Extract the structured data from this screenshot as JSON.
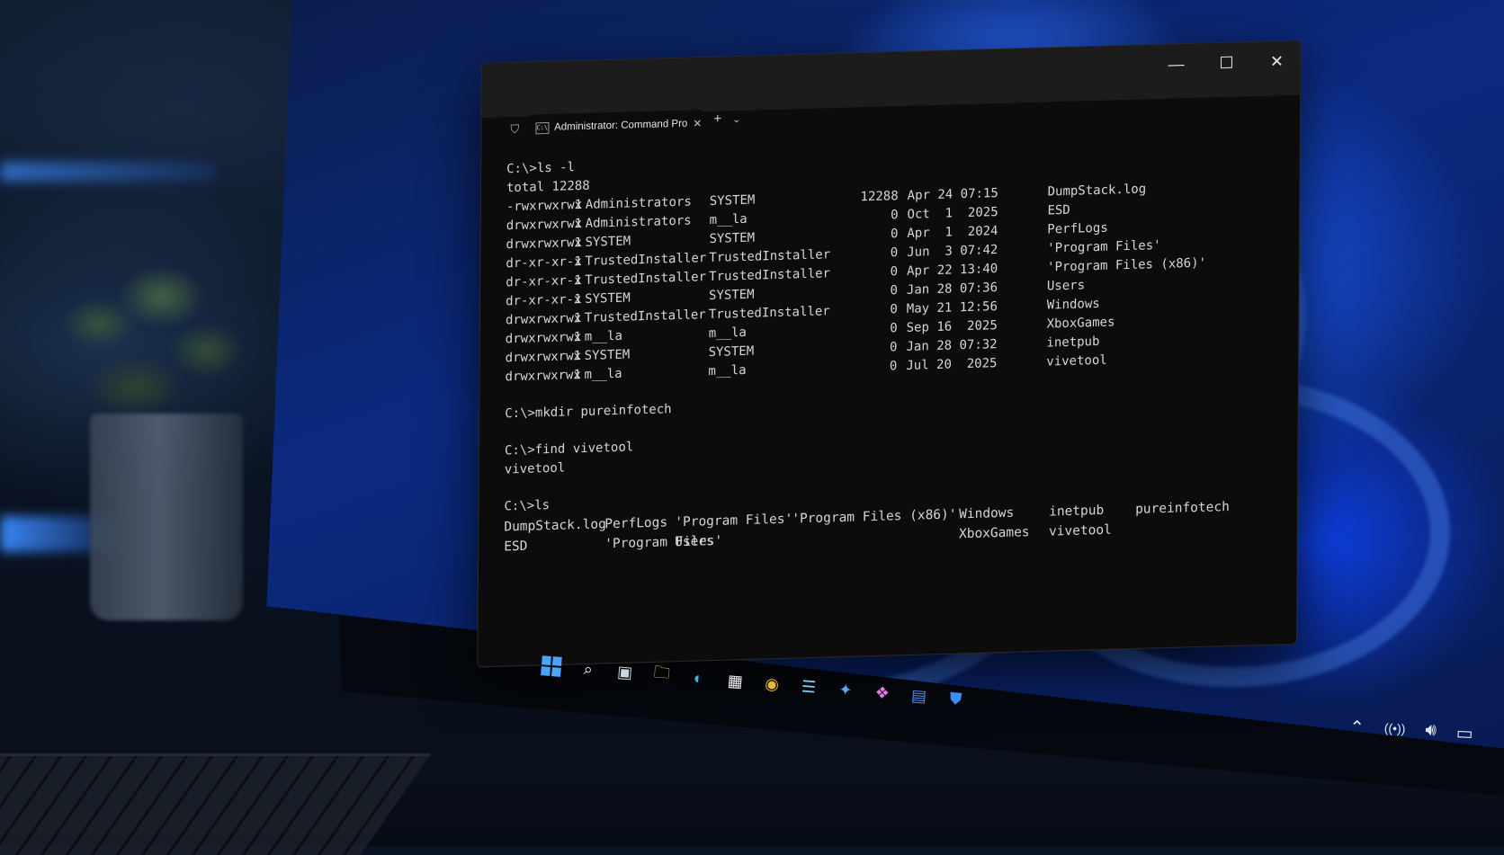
{
  "window": {
    "tab_title": "Administrator: Command Pro",
    "new_tab": "+",
    "dropdown": "⌄",
    "minimize": "—",
    "maximize": "☐",
    "close": "✕",
    "tab_close": "✕",
    "icons": {
      "shield": "shield-icon",
      "cmd": "cmd-icon"
    }
  },
  "terminal": {
    "cmd_ls_l": "C:\\>ls -l",
    "total": "total 12288",
    "listing": [
      {
        "perm": "-rwxrwxrwx",
        "n": "1",
        "owner": "Administrators",
        "group": "SYSTEM",
        "size": "12288",
        "date": "Apr 24 07:15",
        "name": "DumpStack.log"
      },
      {
        "perm": "drwxrwxrwx",
        "n": "1",
        "owner": "Administrators",
        "group": "m__la",
        "size": "0",
        "date": "Oct  1  2025",
        "name": "ESD"
      },
      {
        "perm": "drwxrwxrwx",
        "n": "1",
        "owner": "SYSTEM",
        "group": "SYSTEM",
        "size": "0",
        "date": "Apr  1  2024",
        "name": "PerfLogs"
      },
      {
        "perm": "dr-xr-xr-x",
        "n": "1",
        "owner": "TrustedInstaller",
        "group": "TrustedInstaller",
        "size": "0",
        "date": "Jun  3 07:42",
        "name": "'Program Files'"
      },
      {
        "perm": "dr-xr-xr-x",
        "n": "1",
        "owner": "TrustedInstaller",
        "group": "TrustedInstaller",
        "size": "0",
        "date": "Apr 22 13:40",
        "name": "'Program Files (x86)'"
      },
      {
        "perm": "dr-xr-xr-x",
        "n": "1",
        "owner": "SYSTEM",
        "group": "SYSTEM",
        "size": "0",
        "date": "Jan 28 07:36",
        "name": "Users"
      },
      {
        "perm": "drwxrwxrwx",
        "n": "1",
        "owner": "TrustedInstaller",
        "group": "TrustedInstaller",
        "size": "0",
        "date": "May 21 12:56",
        "name": "Windows"
      },
      {
        "perm": "drwxrwxrwx",
        "n": "1",
        "owner": "m__la",
        "group": "m__la",
        "size": "0",
        "date": "Sep 16  2025",
        "name": "XboxGames"
      },
      {
        "perm": "drwxrwxrwx",
        "n": "1",
        "owner": "SYSTEM",
        "group": "SYSTEM",
        "size": "0",
        "date": "Jan 28 07:32",
        "name": "inetpub"
      },
      {
        "perm": "drwxrwxrwx",
        "n": "1",
        "owner": "m__la",
        "group": "m__la",
        "size": "0",
        "date": "Jul 20  2025",
        "name": "vivetool"
      }
    ],
    "cmd_mkdir": "C:\\>mkdir pureinfotech",
    "cmd_find": "C:\\>find vivetool",
    "find_result": "vivetool",
    "cmd_ls": "C:\\>ls",
    "ls_row1": [
      "DumpStack.log",
      "PerfLogs",
      "'Program Files'",
      "'Program Files (x86)'",
      "Windows",
      "inetpub",
      "pureinfotech"
    ],
    "ls_row2": [
      "ESD",
      "'Program Files'",
      "Users",
      "",
      "XboxGames",
      "vivetool",
      ""
    ]
  },
  "taskbar": {
    "icons": [
      "start-icon",
      "search-icon",
      "task-view-icon",
      "file-explorer-icon",
      "edge-icon",
      "store-icon",
      "chrome-icon",
      "notepad-icon",
      "visual-studio-code-icon",
      "copilot-icon",
      "calculator-icon",
      "defender-icon"
    ],
    "glyphs": {
      "search": "⌕",
      "task_view": "▣",
      "explorer": "🗀",
      "edge": "◐",
      "store": "▦",
      "chrome": "◉",
      "notepad": "☰",
      "vscode": "✦",
      "copilot": "❖",
      "calculator": "▤",
      "defender": "⛊"
    }
  },
  "tray": {
    "chevron": "⌃",
    "wifi": "wifi-icon",
    "volume": "speaker-icon",
    "battery": "battery-icon",
    "glyphs": {
      "chevron": "⌃",
      "wifi": "((•))",
      "volume": "🔊︎",
      "battery": "▭"
    }
  },
  "colors": {
    "terminal_bg": "#0c0c0c",
    "terminal_text": "#d6d6d6",
    "accent_blue": "#1b5cff"
  }
}
